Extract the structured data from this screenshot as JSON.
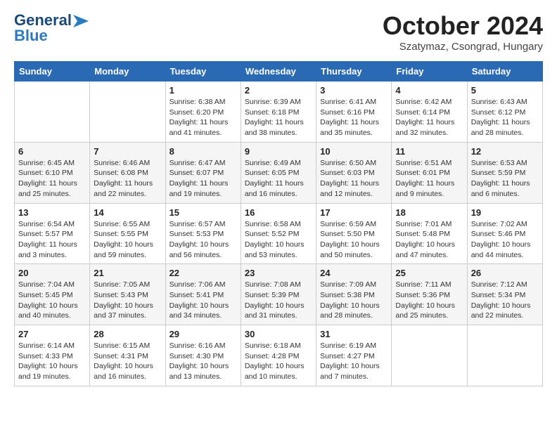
{
  "header": {
    "logo_general": "General",
    "logo_blue": "Blue",
    "month_year": "October 2024",
    "location": "Szatymaz, Csongrad, Hungary"
  },
  "days_of_week": [
    "Sunday",
    "Monday",
    "Tuesday",
    "Wednesday",
    "Thursday",
    "Friday",
    "Saturday"
  ],
  "weeks": [
    [
      {
        "day": "",
        "sunrise": "",
        "sunset": "",
        "daylight": ""
      },
      {
        "day": "",
        "sunrise": "",
        "sunset": "",
        "daylight": ""
      },
      {
        "day": "1",
        "sunrise": "Sunrise: 6:38 AM",
        "sunset": "Sunset: 6:20 PM",
        "daylight": "Daylight: 11 hours and 41 minutes."
      },
      {
        "day": "2",
        "sunrise": "Sunrise: 6:39 AM",
        "sunset": "Sunset: 6:18 PM",
        "daylight": "Daylight: 11 hours and 38 minutes."
      },
      {
        "day": "3",
        "sunrise": "Sunrise: 6:41 AM",
        "sunset": "Sunset: 6:16 PM",
        "daylight": "Daylight: 11 hours and 35 minutes."
      },
      {
        "day": "4",
        "sunrise": "Sunrise: 6:42 AM",
        "sunset": "Sunset: 6:14 PM",
        "daylight": "Daylight: 11 hours and 32 minutes."
      },
      {
        "day": "5",
        "sunrise": "Sunrise: 6:43 AM",
        "sunset": "Sunset: 6:12 PM",
        "daylight": "Daylight: 11 hours and 28 minutes."
      }
    ],
    [
      {
        "day": "6",
        "sunrise": "Sunrise: 6:45 AM",
        "sunset": "Sunset: 6:10 PM",
        "daylight": "Daylight: 11 hours and 25 minutes."
      },
      {
        "day": "7",
        "sunrise": "Sunrise: 6:46 AM",
        "sunset": "Sunset: 6:08 PM",
        "daylight": "Daylight: 11 hours and 22 minutes."
      },
      {
        "day": "8",
        "sunrise": "Sunrise: 6:47 AM",
        "sunset": "Sunset: 6:07 PM",
        "daylight": "Daylight: 11 hours and 19 minutes."
      },
      {
        "day": "9",
        "sunrise": "Sunrise: 6:49 AM",
        "sunset": "Sunset: 6:05 PM",
        "daylight": "Daylight: 11 hours and 16 minutes."
      },
      {
        "day": "10",
        "sunrise": "Sunrise: 6:50 AM",
        "sunset": "Sunset: 6:03 PM",
        "daylight": "Daylight: 11 hours and 12 minutes."
      },
      {
        "day": "11",
        "sunrise": "Sunrise: 6:51 AM",
        "sunset": "Sunset: 6:01 PM",
        "daylight": "Daylight: 11 hours and 9 minutes."
      },
      {
        "day": "12",
        "sunrise": "Sunrise: 6:53 AM",
        "sunset": "Sunset: 5:59 PM",
        "daylight": "Daylight: 11 hours and 6 minutes."
      }
    ],
    [
      {
        "day": "13",
        "sunrise": "Sunrise: 6:54 AM",
        "sunset": "Sunset: 5:57 PM",
        "daylight": "Daylight: 11 hours and 3 minutes."
      },
      {
        "day": "14",
        "sunrise": "Sunrise: 6:55 AM",
        "sunset": "Sunset: 5:55 PM",
        "daylight": "Daylight: 10 hours and 59 minutes."
      },
      {
        "day": "15",
        "sunrise": "Sunrise: 6:57 AM",
        "sunset": "Sunset: 5:53 PM",
        "daylight": "Daylight: 10 hours and 56 minutes."
      },
      {
        "day": "16",
        "sunrise": "Sunrise: 6:58 AM",
        "sunset": "Sunset: 5:52 PM",
        "daylight": "Daylight: 10 hours and 53 minutes."
      },
      {
        "day": "17",
        "sunrise": "Sunrise: 6:59 AM",
        "sunset": "Sunset: 5:50 PM",
        "daylight": "Daylight: 10 hours and 50 minutes."
      },
      {
        "day": "18",
        "sunrise": "Sunrise: 7:01 AM",
        "sunset": "Sunset: 5:48 PM",
        "daylight": "Daylight: 10 hours and 47 minutes."
      },
      {
        "day": "19",
        "sunrise": "Sunrise: 7:02 AM",
        "sunset": "Sunset: 5:46 PM",
        "daylight": "Daylight: 10 hours and 44 minutes."
      }
    ],
    [
      {
        "day": "20",
        "sunrise": "Sunrise: 7:04 AM",
        "sunset": "Sunset: 5:45 PM",
        "daylight": "Daylight: 10 hours and 40 minutes."
      },
      {
        "day": "21",
        "sunrise": "Sunrise: 7:05 AM",
        "sunset": "Sunset: 5:43 PM",
        "daylight": "Daylight: 10 hours and 37 minutes."
      },
      {
        "day": "22",
        "sunrise": "Sunrise: 7:06 AM",
        "sunset": "Sunset: 5:41 PM",
        "daylight": "Daylight: 10 hours and 34 minutes."
      },
      {
        "day": "23",
        "sunrise": "Sunrise: 7:08 AM",
        "sunset": "Sunset: 5:39 PM",
        "daylight": "Daylight: 10 hours and 31 minutes."
      },
      {
        "day": "24",
        "sunrise": "Sunrise: 7:09 AM",
        "sunset": "Sunset: 5:38 PM",
        "daylight": "Daylight: 10 hours and 28 minutes."
      },
      {
        "day": "25",
        "sunrise": "Sunrise: 7:11 AM",
        "sunset": "Sunset: 5:36 PM",
        "daylight": "Daylight: 10 hours and 25 minutes."
      },
      {
        "day": "26",
        "sunrise": "Sunrise: 7:12 AM",
        "sunset": "Sunset: 5:34 PM",
        "daylight": "Daylight: 10 hours and 22 minutes."
      }
    ],
    [
      {
        "day": "27",
        "sunrise": "Sunrise: 6:14 AM",
        "sunset": "Sunset: 4:33 PM",
        "daylight": "Daylight: 10 hours and 19 minutes."
      },
      {
        "day": "28",
        "sunrise": "Sunrise: 6:15 AM",
        "sunset": "Sunset: 4:31 PM",
        "daylight": "Daylight: 10 hours and 16 minutes."
      },
      {
        "day": "29",
        "sunrise": "Sunrise: 6:16 AM",
        "sunset": "Sunset: 4:30 PM",
        "daylight": "Daylight: 10 hours and 13 minutes."
      },
      {
        "day": "30",
        "sunrise": "Sunrise: 6:18 AM",
        "sunset": "Sunset: 4:28 PM",
        "daylight": "Daylight: 10 hours and 10 minutes."
      },
      {
        "day": "31",
        "sunrise": "Sunrise: 6:19 AM",
        "sunset": "Sunset: 4:27 PM",
        "daylight": "Daylight: 10 hours and 7 minutes."
      },
      {
        "day": "",
        "sunrise": "",
        "sunset": "",
        "daylight": ""
      },
      {
        "day": "",
        "sunrise": "",
        "sunset": "",
        "daylight": ""
      }
    ]
  ]
}
